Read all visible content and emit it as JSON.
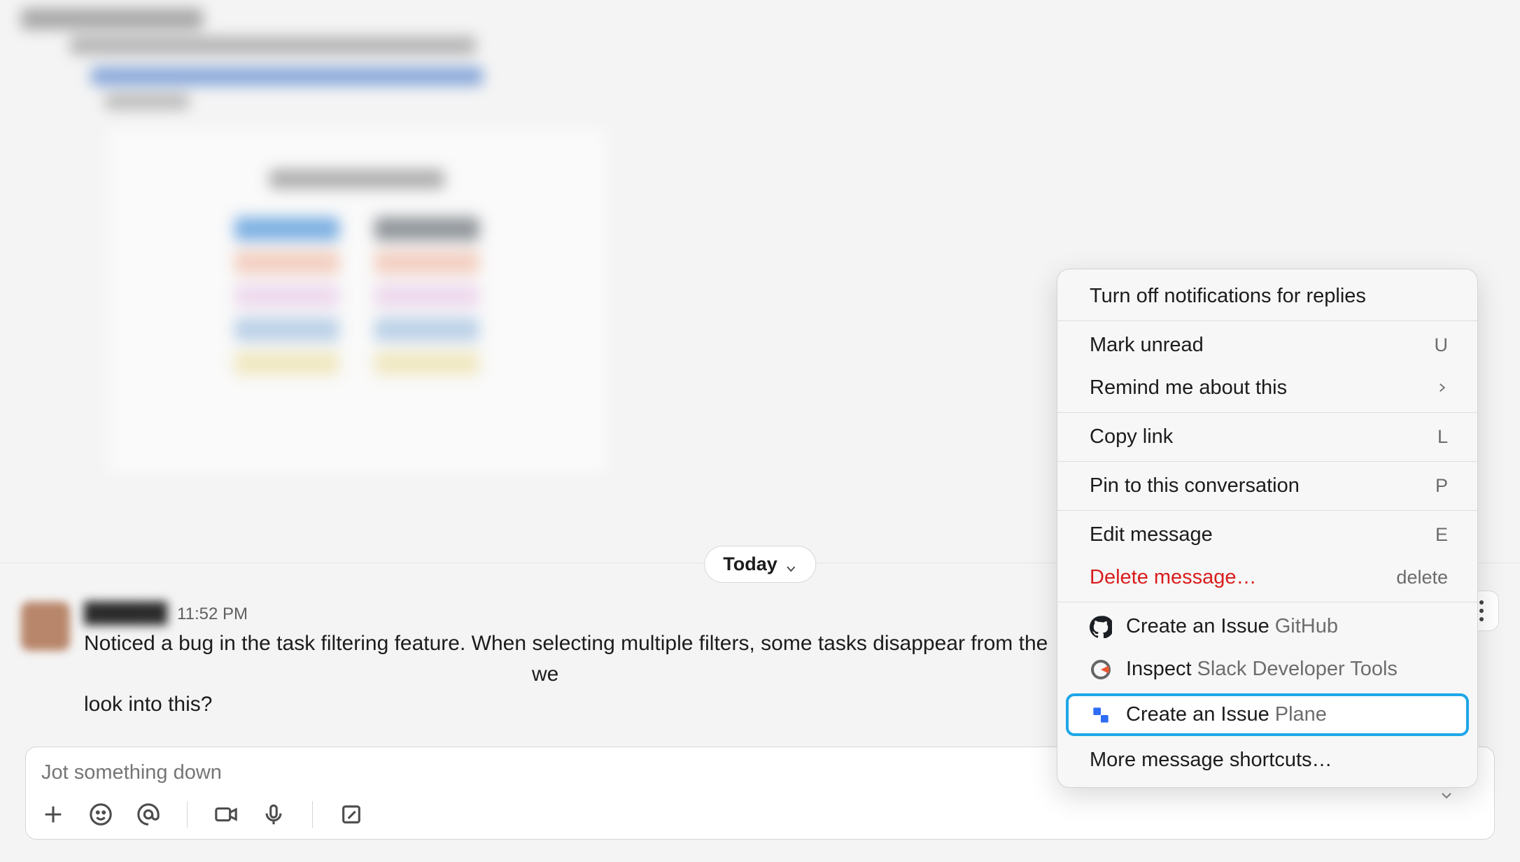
{
  "date_divider": {
    "label": "Today"
  },
  "message": {
    "timestamp": "11:52 PM",
    "text_line1": "Noticed a bug in the task filtering feature. When selecting multiple filters, some tasks disappear from the",
    "text_tail": "we",
    "text_line2": "look into this?"
  },
  "composer": {
    "placeholder": "Jot something down"
  },
  "context_menu": {
    "notifications": "Turn off notifications for replies",
    "mark_unread": {
      "label": "Mark unread",
      "key": "U"
    },
    "remind": {
      "label": "Remind me about this"
    },
    "copy_link": {
      "label": "Copy link",
      "key": "L"
    },
    "pin": {
      "label": "Pin to this conversation",
      "key": "P"
    },
    "edit": {
      "label": "Edit message",
      "key": "E"
    },
    "delete": {
      "label": "Delete message…",
      "key": "delete"
    },
    "github": {
      "label": "Create an Issue",
      "sub": "GitHub"
    },
    "inspect": {
      "label": "Inspect",
      "sub": "Slack Developer Tools"
    },
    "plane": {
      "label": "Create an Issue",
      "sub": "Plane"
    },
    "more": {
      "label": "More message shortcuts…"
    }
  }
}
